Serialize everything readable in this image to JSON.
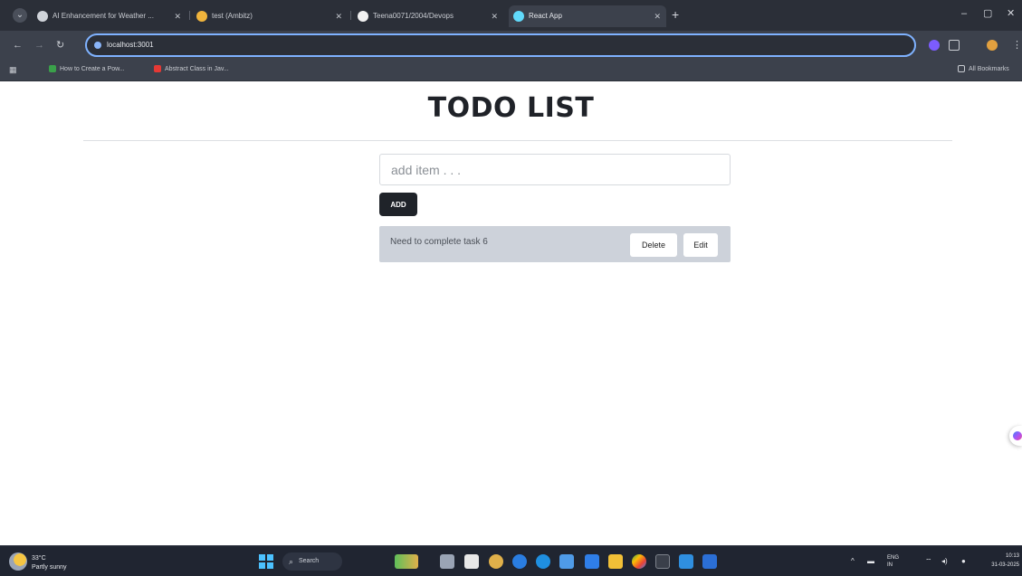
{
  "browser": {
    "tabs": [
      {
        "title": "AI Enhancement for Weather ...",
        "active": false
      },
      {
        "title": "test (Ambitz)",
        "active": false
      },
      {
        "title": "Teena0071/2004/Devops",
        "active": false
      },
      {
        "title": "React App",
        "active": true
      }
    ],
    "new_tab_label": "+",
    "window_controls": {
      "minimize": "–",
      "maximize": "▢",
      "close": "✕"
    },
    "address_url": "localhost:3001",
    "bookmarks": [
      {
        "label": "How to Create a Pow..."
      },
      {
        "label": "Abstract Class in Jav..."
      }
    ],
    "all_bookmarks_label": "All Bookmarks"
  },
  "page": {
    "title": "TODO LIST",
    "input": {
      "placeholder": "add item . . .",
      "value": ""
    },
    "add_button_label": "ADD",
    "items": [
      {
        "text": "Need to complete task 6",
        "delete_label": "Delete",
        "edit_label": "Edit"
      }
    ]
  },
  "taskbar": {
    "weather_temp": "33°C",
    "weather_desc": "Partly sunny",
    "search_label": "Search",
    "lang_line1": "ENG",
    "lang_line2": "IN",
    "time": "10:13",
    "date": "31-03-2025"
  },
  "colors": {
    "page_bg": "#ffffff",
    "item_bg": "#cdd2da",
    "add_button_bg": "#1f2329",
    "omnibox_focus": "#7fb2ff",
    "chrome_dark": "#2b2f38",
    "taskbar_bg": "#202531"
  }
}
